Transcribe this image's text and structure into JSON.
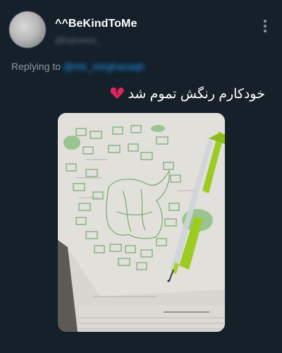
{
  "tweet": {
    "display_name": "^^BeKindToMe",
    "handle": "@kaineisis_",
    "replying_label": "Replying to",
    "replying_handle": "@mir_mirghazaqh",
    "text": "خودکارم رنگش تموم شد",
    "emoji": "broken-heart-icon"
  },
  "colors": {
    "background": "#15202b",
    "primary_text": "#ffffff",
    "secondary_text": "#8b98a5",
    "accent": "#1d9bf0",
    "heart": "#e0245e",
    "pen_green": "#a6d22c"
  },
  "icons": {
    "more": "more-vertical-icon",
    "heart": "broken-heart-icon"
  }
}
